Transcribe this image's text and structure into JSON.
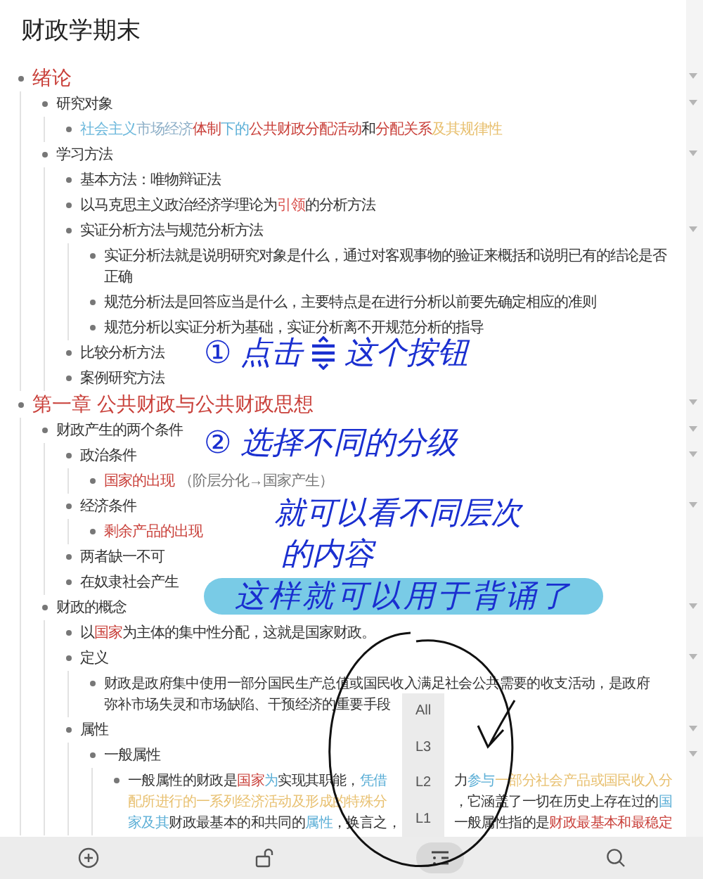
{
  "title": "财政学期末",
  "outline": [
    {
      "text": "绪论",
      "expanded": true,
      "children": [
        {
          "text": "研究对象",
          "expanded": true,
          "children": [
            {
              "segments": [
                {
                  "text": "社会主义",
                  "color": "#6cb8dc"
                },
                {
                  "text": "市场经济",
                  "color": "#8fb0c8"
                },
                {
                  "text": "体制",
                  "color": "#c9403a"
                },
                {
                  "text": "下的",
                  "color": "#5aaed6"
                },
                {
                  "text": "公共财政分配活动",
                  "color": "#c9403a"
                },
                {
                  "text": "和"
                },
                {
                  "text": "分配关系",
                  "color": "#c9403a"
                },
                {
                  "text": "及其规律性",
                  "color": "#e8c070"
                }
              ]
            }
          ]
        },
        {
          "text": "学习方法",
          "expanded": true,
          "children": [
            {
              "text": "基本方法：唯物辩证法"
            },
            {
              "segments": [
                {
                  "text": "以马克思主义政治经济学理论为"
                },
                {
                  "text": "引领",
                  "color": "#d9534f"
                },
                {
                  "text": "的分析方法"
                }
              ]
            },
            {
              "text": "实证分析方法与规范分析方法",
              "expanded": true,
              "children": [
                {
                  "text": "实证分析法就是说明研究对象是什么，通过对客观事物的验证来概括和说明已有的结论是否正确"
                },
                {
                  "text": "规范分析法是回答应当是什么，主要特点是在进行分析以前要先确定相应的准则"
                },
                {
                  "text": "规范分析以实证分析为基础，实证分析离不开规范分析的指导"
                }
              ]
            },
            {
              "text": "比较分析方法"
            },
            {
              "text": "案例研究方法"
            }
          ]
        }
      ]
    },
    {
      "text": "第一章 公共财政与公共财政思想",
      "expanded": true,
      "children": [
        {
          "text": "财政产生的两个条件",
          "expanded": true,
          "children": [
            {
              "text": "政治条件",
              "expanded": true,
              "children": [
                {
                  "segments": [
                    {
                      "text": "国家的出现",
                      "color": "#c9403a"
                    },
                    {
                      "text": " （阶层分化→国家产生）",
                      "color": "#777777"
                    }
                  ]
                }
              ]
            },
            {
              "text": "经济条件",
              "expanded": true,
              "children": [
                {
                  "segments": [
                    {
                      "text": "剩余产品的出现",
                      "color": "#c9403a"
                    }
                  ]
                }
              ]
            },
            {
              "text": "两者缺一不可"
            },
            {
              "text": "在奴隶社会产生"
            }
          ]
        },
        {
          "text": "财政的概念",
          "expanded": true,
          "children": [
            {
              "segments": [
                {
                  "text": "以"
                },
                {
                  "text": "国家",
                  "color": "#c9403a"
                },
                {
                  "text": "为主体的集中性分配，这就是国家财政。"
                }
              ]
            },
            {
              "text": "定义",
              "expanded": true,
              "children": [
                {
                  "lines": [
                    [
                      [
                        {
                          "text": "财政是政府集中使用一部分国民生产总值或国民收入满足社会公共需要的收支活动，是政府"
                        }
                      ]
                    ],
                    [
                      [
                        {
                          "text": "弥补市场失灵和市场缺陷、干预经济的重要手段"
                        }
                      ]
                    ]
                  ]
                }
              ]
            },
            {
              "text": "属性",
              "expanded": true,
              "children": [
                {
                  "text": "一般属性",
                  "expanded": true,
                  "children": [
                    {
                      "lines": [
                        [
                          [
                            {
                              "text": "一般属性的财政是"
                            },
                            {
                              "text": "国家",
                              "color": "#c9403a"
                            },
                            {
                              "text": "为",
                              "color": "#5aaed6"
                            },
                            {
                              "text": "实现其职能，"
                            },
                            {
                              "text": "凭借",
                              "color": "#5aaed6"
                            }
                          ],
                          [
                            {
                              "text": "力"
                            },
                            {
                              "text": "参与",
                              "color": "#5aaed6"
                            },
                            {
                              "text": "一部分社会产品或国民收入分",
                              "color": "#e8c070"
                            }
                          ]
                        ],
                        [
                          [
                            {
                              "text": "配所进行的一系列经济活动及形成的特殊分",
                              "color": "#e8c070"
                            }
                          ],
                          [
                            {
                              "text": "，它涵盖了一切在历史上存在过的"
                            },
                            {
                              "text": "国",
                              "color": "#5aaed6"
                            }
                          ]
                        ],
                        [
                          [
                            {
                              "text": "家及其",
                              "color": "#5aaed6"
                            },
                            {
                              "text": "财政最基本的和共同的"
                            },
                            {
                              "text": "属性",
                              "color": "#5aaed6"
                            },
                            {
                              "text": "，换言之，"
                            }
                          ],
                          [
                            {
                              "text": "一般属性指的是"
                            },
                            {
                              "text": "财政最基本和最稳定",
                              "color": "#c9403a"
                            }
                          ]
                        ]
                      ]
                    }
                  ]
                }
              ]
            }
          ]
        }
      ]
    }
  ],
  "level_menu": [
    {
      "label": "All"
    },
    {
      "label": "L3"
    },
    {
      "label": "L2"
    },
    {
      "label": "L1"
    }
  ],
  "toolbar": [
    {
      "kind": "add",
      "selected": false
    },
    {
      "kind": "lock",
      "selected": false
    },
    {
      "kind": "levels",
      "selected": true
    },
    {
      "kind": "search",
      "selected": false
    }
  ],
  "annotations": [
    {
      "before": "① 点击",
      "after": "这个按钮",
      "highlighted": false
    },
    {
      "text": "② 选择不同的分级",
      "highlighted": false
    },
    {
      "text": "就可以看不同层次",
      "highlighted": false
    },
    {
      "text": "的内容",
      "highlighted": false
    },
    {
      "text": "这样就可以用于背诵了",
      "highlighted": true
    }
  ]
}
